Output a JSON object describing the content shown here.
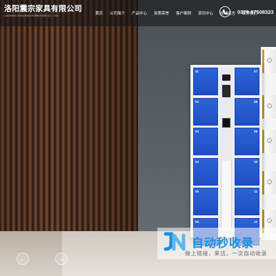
{
  "brand": {
    "title": "洛阳震宗家具有限公司",
    "subtitle": "LUOYANG ZHOUXING FURNITURE CO., LTD"
  },
  "nav": {
    "items": [
      {
        "label": "首页"
      },
      {
        "label": "公司简介"
      },
      {
        "label": "产品中心"
      },
      {
        "label": "资质荣誉"
      },
      {
        "label": "客户案例"
      },
      {
        "label": "资讯中心"
      },
      {
        "label": "在线留言"
      },
      {
        "label": "联系我们"
      }
    ]
  },
  "contact": {
    "phone": "0379-67508323",
    "icon": "phone-icon"
  },
  "locker": {
    "left_numbers": [
      "01",
      "02",
      "03",
      "04",
      "05",
      "06"
    ],
    "right_numbers": [
      "07",
      "08",
      "09",
      "10",
      "11",
      "12"
    ],
    "door_color": "#1f54c8"
  },
  "carousel": {
    "prev_icon": "←",
    "next_icon": "→"
  },
  "watermark": {
    "title": "自动秒收录",
    "subtitle": "做上链接，来访，一次自动收录"
  },
  "colors": {
    "nav_bg": "rgba(20,20,22,0.55)",
    "accent_blue": "#1d8de0",
    "wood": "#5a3826"
  }
}
